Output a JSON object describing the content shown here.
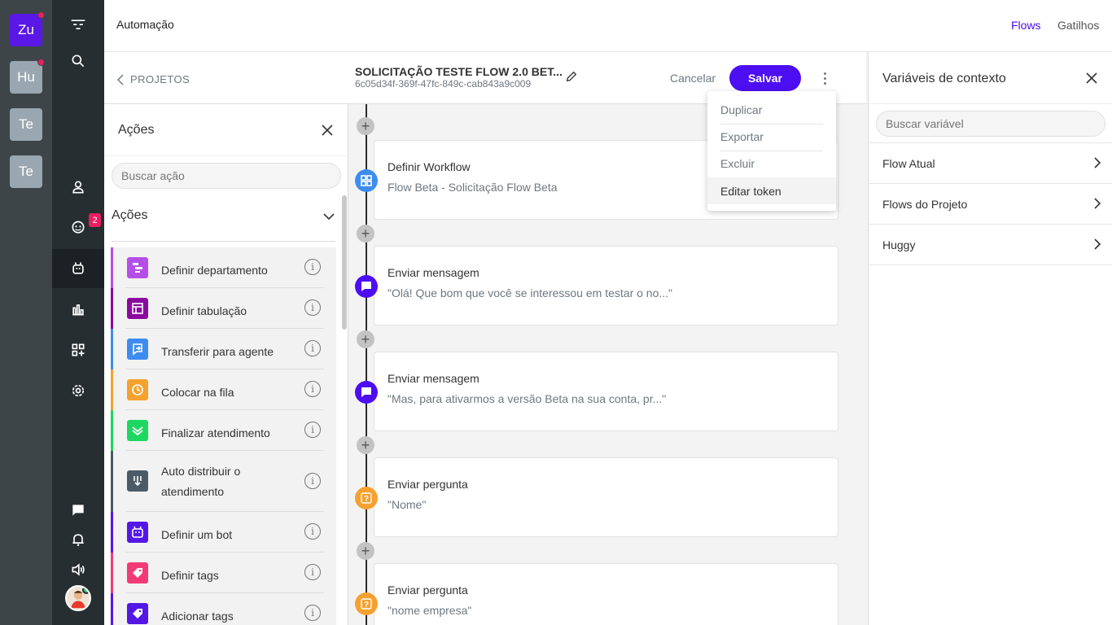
{
  "workspaces": [
    {
      "label": "Zu",
      "active": true,
      "notify": true
    },
    {
      "label": "Hu",
      "active": false,
      "notify": true
    },
    {
      "label": "Te",
      "active": false,
      "notify": false
    },
    {
      "label": "Te",
      "active": false,
      "notify": false
    }
  ],
  "nav": {
    "chat_badge": "2",
    "items": [
      "search-icon",
      "contacts-icon",
      "chat-icon",
      "bot-icon",
      "reports-icon",
      "apps-icon",
      "settings-icon",
      "messages-icon",
      "bell-icon",
      "volume-icon"
    ]
  },
  "topbar": {
    "title": "Automação",
    "links": [
      "Flows",
      "Gatilhos"
    ],
    "active_link_color": "#4d0ef2"
  },
  "project": {
    "back_label": "PROJETOS",
    "flow_name": "SOLICITAÇÃO TESTE FLOW 2.0 BET...",
    "flow_id": "6c05d34f-369f-47fc-849c-cab843a9c009",
    "cancel_label": "Cancelar",
    "save_label": "Salvar"
  },
  "menu": {
    "items": [
      "Duplicar",
      "Exportar",
      "Excluir",
      "Editar token"
    ],
    "highlighted": "Editar token"
  },
  "actions_panel": {
    "title": "Ações",
    "search_placeholder": "Buscar ação",
    "section_title": "Ações",
    "items": [
      {
        "label": "Definir departamento",
        "color": "#b34ee8",
        "icon": "department-icon"
      },
      {
        "label": "Definir tabulação",
        "color": "#8a0aa0",
        "icon": "tabulation-icon"
      },
      {
        "label": "Transferir para agente",
        "color": "#3e8cf0",
        "icon": "transfer-icon"
      },
      {
        "label": "Colocar na fila",
        "color": "#f5a130",
        "icon": "clock-icon"
      },
      {
        "label": "Finalizar atendimento",
        "color": "#1ed760",
        "icon": "double-check-icon"
      },
      {
        "label": "Auto distribuir o atendimento",
        "color": "#4a5a66",
        "icon": "distribute-icon"
      },
      {
        "label": "Definir um bot",
        "color": "#5418e6",
        "icon": "bot-icon"
      },
      {
        "label": "Definir tags",
        "color": "#f23a76",
        "icon": "tag-icon"
      },
      {
        "label": "Adicionar tags",
        "color": "#5418e6",
        "icon": "tag-icon"
      }
    ]
  },
  "flow_steps": [
    {
      "title": "Definir Workflow",
      "detail": "Flow Beta - Solicitação Flow Beta",
      "color": "#3e8cf0",
      "icon": "workflow-icon"
    },
    {
      "title": "Enviar mensagem",
      "detail": "\"Olá! Que bom que você se interessou em testar o no...\"",
      "color": "#4d0ef2",
      "icon": "message-icon"
    },
    {
      "title": "Enviar mensagem",
      "detail": "\"Mas, para ativarmos a versão Beta na sua conta, pr...\"",
      "color": "#4d0ef2",
      "icon": "message-icon"
    },
    {
      "title": "Enviar pergunta",
      "detail": "\"Nome\"",
      "color": "#f5a130",
      "icon": "question-icon"
    },
    {
      "title": "Enviar pergunta",
      "detail": "\"nome empresa\"",
      "color": "#f5a130",
      "icon": "question-icon"
    }
  ],
  "vars_panel": {
    "title": "Variáveis de contexto",
    "search_placeholder": "Buscar variável",
    "rows": [
      "Flow Atual",
      "Flows do Projeto",
      "Huggy"
    ]
  }
}
